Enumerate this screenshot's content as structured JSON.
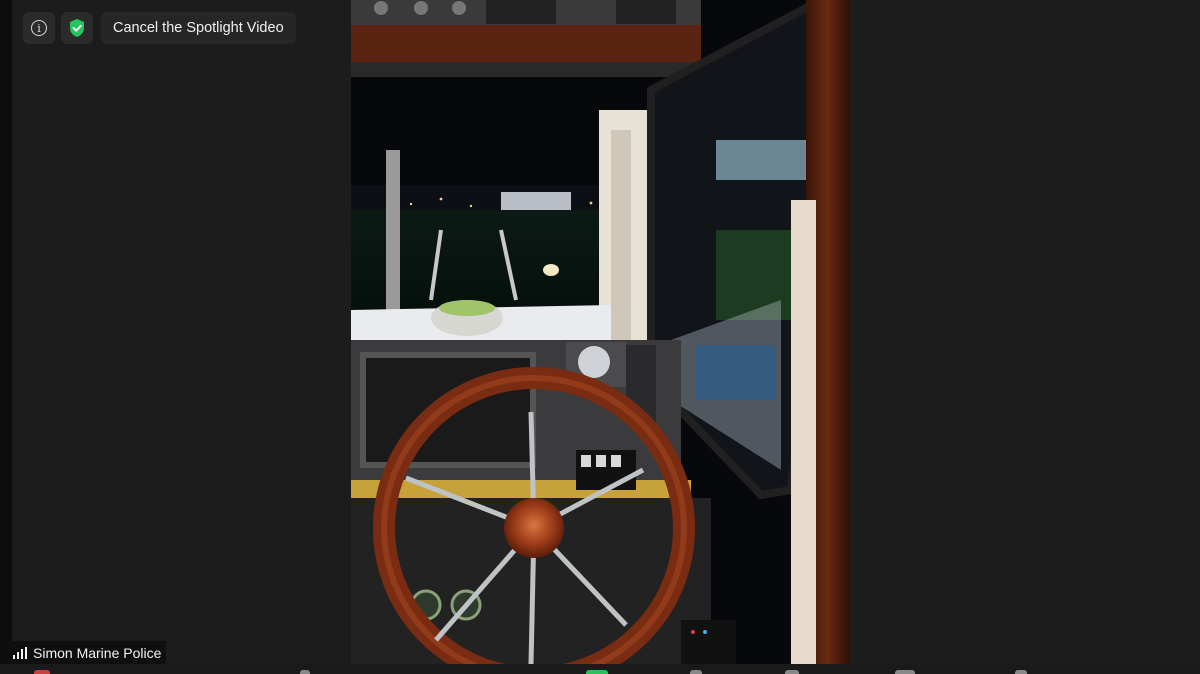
{
  "toolbar": {
    "info_icon": "info-icon",
    "security_icon": "shield-check-icon",
    "security_color": "#22c55e",
    "spotlight_label": "Cancel the Spotlight Video"
  },
  "participant": {
    "name": "Simon Marine Police",
    "signal_icon": "signal-bars-icon"
  },
  "video": {
    "description_icon": "participant-video-feed"
  },
  "colors": {
    "background": "#1c1c1c",
    "panel": "#2b2b2b",
    "text": "#f0f0f0"
  }
}
